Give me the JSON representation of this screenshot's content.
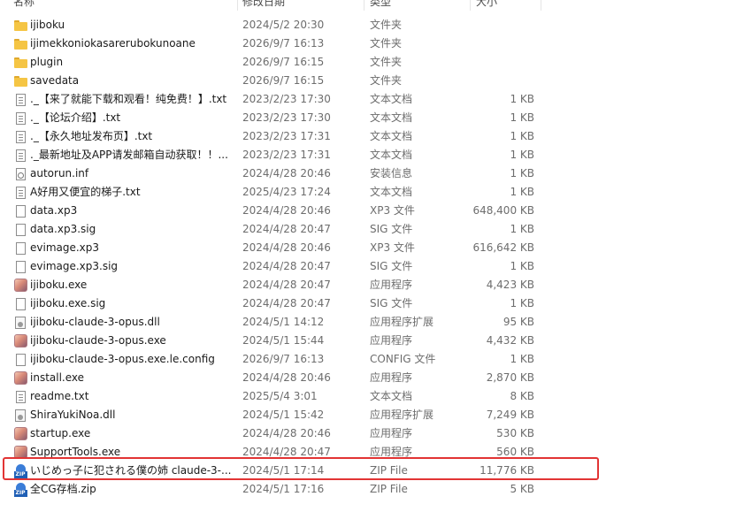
{
  "columns": {
    "name": "名称",
    "date": "修改日期",
    "type": "类型",
    "size": "大小"
  },
  "files": [
    {
      "icon": "folder-icon",
      "name": "ijiboku",
      "date": "2024/5/2 20:30",
      "type": "文件夹",
      "size": ""
    },
    {
      "icon": "folder-icon",
      "name": "ijimekkoniokasarerubokunoane",
      "date": "2026/9/7 16:13",
      "type": "文件夹",
      "size": ""
    },
    {
      "icon": "folder-icon",
      "name": "plugin",
      "date": "2026/9/7 16:15",
      "type": "文件夹",
      "size": ""
    },
    {
      "icon": "folder-icon",
      "name": "savedata",
      "date": "2026/9/7 16:15",
      "type": "文件夹",
      "size": ""
    },
    {
      "icon": "text-file-icon",
      "name": "._【来了就能下载和观看！纯免费！】.txt",
      "date": "2023/2/23 17:30",
      "type": "文本文档",
      "size": "1 KB"
    },
    {
      "icon": "text-file-icon",
      "name": "._【论坛介绍】.txt",
      "date": "2023/2/23 17:30",
      "type": "文本文档",
      "size": "1 KB"
    },
    {
      "icon": "text-file-icon",
      "name": "._【永久地址发布页】.txt",
      "date": "2023/2/23 17:31",
      "type": "文本文档",
      "size": "1 KB"
    },
    {
      "icon": "text-file-icon",
      "name": "._最新地址及APP请发邮箱自动获取！！...",
      "date": "2023/2/23 17:31",
      "type": "文本文档",
      "size": "1 KB"
    },
    {
      "icon": "setup-info-icon",
      "name": "autorun.inf",
      "date": "2024/4/28 20:46",
      "type": "安装信息",
      "size": "1 KB"
    },
    {
      "icon": "text-file-icon",
      "name": "A好用又便宜的梯子.txt",
      "date": "2025/4/23 17:24",
      "type": "文本文档",
      "size": "1 KB"
    },
    {
      "icon": "blank-file-icon",
      "name": "data.xp3",
      "date": "2024/4/28 20:46",
      "type": "XP3 文件",
      "size": "648,400 KB"
    },
    {
      "icon": "blank-file-icon",
      "name": "data.xp3.sig",
      "date": "2024/4/28 20:47",
      "type": "SIG 文件",
      "size": "1 KB"
    },
    {
      "icon": "blank-file-icon",
      "name": "evimage.xp3",
      "date": "2024/4/28 20:46",
      "type": "XP3 文件",
      "size": "616,642 KB"
    },
    {
      "icon": "blank-file-icon",
      "name": "evimage.xp3.sig",
      "date": "2024/4/28 20:47",
      "type": "SIG 文件",
      "size": "1 KB"
    },
    {
      "icon": "app-icon",
      "name": "ijiboku.exe",
      "date": "2024/4/28 20:47",
      "type": "应用程序",
      "size": "4,423 KB"
    },
    {
      "icon": "blank-file-icon",
      "name": "ijiboku.exe.sig",
      "date": "2024/4/28 20:47",
      "type": "SIG 文件",
      "size": "1 KB"
    },
    {
      "icon": "dll-icon",
      "name": "ijiboku-claude-3-opus.dll",
      "date": "2024/5/1 14:12",
      "type": "应用程序扩展",
      "size": "95 KB"
    },
    {
      "icon": "app-icon",
      "name": "ijiboku-claude-3-opus.exe",
      "date": "2024/5/1 15:44",
      "type": "应用程序",
      "size": "4,432 KB"
    },
    {
      "icon": "blank-file-icon",
      "name": "ijiboku-claude-3-opus.exe.le.config",
      "date": "2026/9/7 16:13",
      "type": "CONFIG 文件",
      "size": "1 KB"
    },
    {
      "icon": "app-icon",
      "name": "install.exe",
      "date": "2024/4/28 20:46",
      "type": "应用程序",
      "size": "2,870 KB"
    },
    {
      "icon": "text-file-icon",
      "name": "readme.txt",
      "date": "2025/5/4 3:01",
      "type": "文本文档",
      "size": "8 KB"
    },
    {
      "icon": "dll-icon",
      "name": "ShiraYukiNoa.dll",
      "date": "2024/5/1 15:42",
      "type": "应用程序扩展",
      "size": "7,249 KB"
    },
    {
      "icon": "app-icon",
      "name": "startup.exe",
      "date": "2024/4/28 20:46",
      "type": "应用程序",
      "size": "530 KB"
    },
    {
      "icon": "app-icon",
      "name": "SupportTools.exe",
      "date": "2024/4/28 20:47",
      "type": "应用程序",
      "size": "560 KB"
    },
    {
      "icon": "zip-icon",
      "name": "いじめっ子に犯される僕の姉 claude-3-...",
      "date": "2024/5/1 17:14",
      "type": "ZIP File",
      "size": "11,776 KB"
    },
    {
      "icon": "zip-icon",
      "name": "全CG存档.zip",
      "date": "2024/5/1 17:16",
      "type": "ZIP File",
      "size": "5 KB"
    }
  ],
  "highlight_color": "#e23434",
  "folder_color": "#f5c544"
}
